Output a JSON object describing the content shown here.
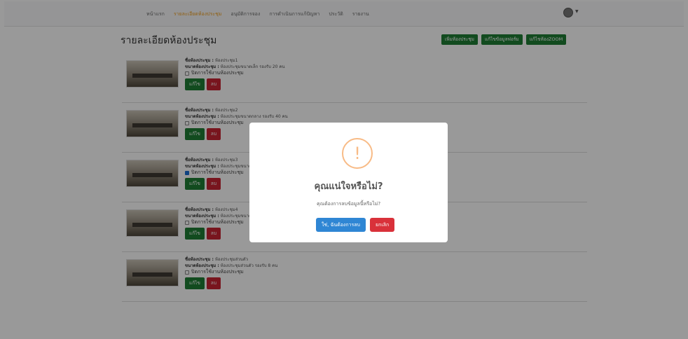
{
  "nav": {
    "links": [
      {
        "label": "หน้าแรก",
        "active": false
      },
      {
        "label": "รายละเอียดห้องประชุม",
        "active": true
      },
      {
        "label": "อนุมัติการจอง",
        "active": false
      },
      {
        "label": "การดำเนินการแก้ปัญหา",
        "active": false
      },
      {
        "label": "ประวัติ",
        "active": false
      },
      {
        "label": "รายงาน",
        "active": false
      }
    ],
    "avatar_icon": "user-avatar-icon"
  },
  "page": {
    "title": "รายละเอียดห้องประชุม",
    "buttons": [
      "เพิ่มห้องประชุม",
      "แก้ไขข้อมูลฟอร์ม",
      "แก้ไขห้องZOOM"
    ]
  },
  "rooms": [
    {
      "name_label": "ชื่อห้องประชุม :",
      "name": "ห้องประชุม1",
      "size_label": "ขนาดห้องประชุม :",
      "size": "ห้องประชุมขนาดเล็ก รองรับ 20 คน",
      "close_label": "ปิดการใช้งานห้องประชุม",
      "closed": false,
      "edit": "แก้ไข",
      "delete": "ลบ"
    },
    {
      "name_label": "ชื่อห้องประชุม :",
      "name": "ห้องประชุม2",
      "size_label": "ขนาดห้องประชุม :",
      "size": "ห้องประชุมขนาดกลาง รองรับ 40 คน",
      "close_label": "ปิดการใช้งานห้องประชุม",
      "closed": false,
      "edit": "แก้ไข",
      "delete": "ลบ"
    },
    {
      "name_label": "ชื่อห้องประชุม :",
      "name": "ห้องประชุม3",
      "size_label": "ขนาดห้องประชุม :",
      "size": "ห้องประชุมขนาดกล",
      "close_label": "ปิดการใช้งานห้องประชุม",
      "closed": true,
      "edit": "แก้ไข",
      "delete": "ลบ"
    },
    {
      "name_label": "ชื่อห้องประชุม :",
      "name": "ห้องประชุม4",
      "size_label": "ขนาดห้องประชุม :",
      "size": "ห้องประชุมขนาดกล",
      "close_label": "ปิดการใช้งานห้องประชุม",
      "closed": false,
      "edit": "แก้ไข",
      "delete": "ลบ"
    },
    {
      "name_label": "ชื่อห้องประชุม :",
      "name": "ห้องประชุมส่วนตัว",
      "size_label": "ขนาดห้องประชุม :",
      "size": "ห้องประชุมส่วนตัว รองรับ 8 คน",
      "close_label": "ปิดการใช้งานห้องประชุม",
      "closed": false,
      "edit": "แก้ไข",
      "delete": "ลบ"
    }
  ],
  "modal": {
    "icon": "warning-icon",
    "icon_glyph": "!",
    "title": "คุณแน่ใจหรือไม่?",
    "text": "คุณต้องการลบข้อมูลนี้หรือไม่?",
    "confirm": "ใช่, ฉันต้องการลบ",
    "cancel": "ยกเลิก"
  },
  "colors": {
    "accent_orange": "#f0a020",
    "green": "#1e7e34",
    "red": "#c82333",
    "confirm_blue": "#2f86d4",
    "warning": "#f8bb86"
  }
}
